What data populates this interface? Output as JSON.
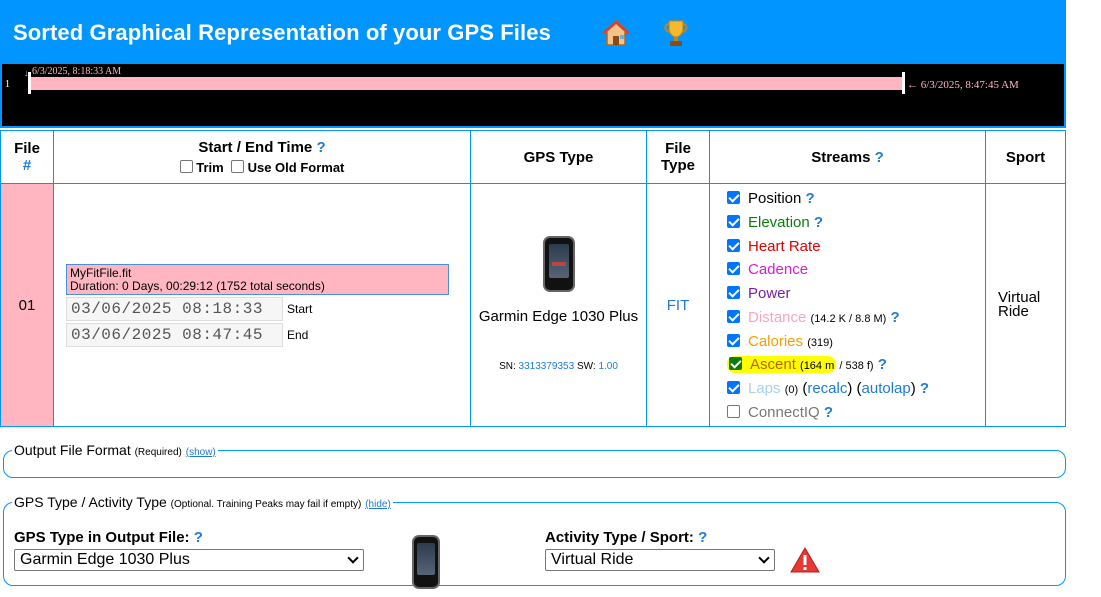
{
  "header": {
    "title": "Sorted Graphical Representation of your GPS Files",
    "home_icon": "house-icon",
    "trophy_icon": "trophy-icon",
    "color": "#0095ff"
  },
  "timeline": {
    "row_number": "1",
    "start_label": "6/3/2025, 8:18:33 AM",
    "end_label": "← 6/3/2025, 8:47:45 AM",
    "bar_color": "#ffb6c1"
  },
  "table": {
    "headers": {
      "file": "File",
      "file_hash": "#",
      "start_end": "Start / End Time",
      "q": "?",
      "trim": "Trim",
      "use_old_format": "Use Old Format",
      "gps_type": "GPS Type",
      "file_type_1": "File",
      "file_type_2": "Type",
      "streams": "Streams",
      "sport": "Sport"
    },
    "row": {
      "number": "01",
      "file_name": "MyFitFile.fit",
      "duration": "Duration: 0 Days, 00:29:12 (1752 total seconds)",
      "start_value": "03/06/2025 08:18:33",
      "start_label": "Start",
      "end_value": "03/06/2025 08:47:45",
      "end_label": "End",
      "gps_name": "Garmin Edge 1030 Plus",
      "sn_label": "SN:",
      "sn_value": "3313379353",
      "sw_label": "SW:",
      "sw_value": "1.00",
      "file_type": "FIT",
      "sport": "Virtual Ride"
    },
    "streams": {
      "position": "Position",
      "elevation": "Elevation",
      "heart_rate": "Heart Rate",
      "cadence": "Cadence",
      "power": "Power",
      "distance": "Distance",
      "distance_detail": "(14.2 K / 8.8 M)",
      "calories": "Calories",
      "calories_detail": "(319)",
      "ascent": "Ascent",
      "ascent_detail_a": "(164 m",
      "ascent_detail_b": "/ 538 f)",
      "laps": "Laps",
      "laps_detail": "(0)",
      "recalc": "recalc",
      "autolap": "autolap",
      "connectiq": "ConnectIQ",
      "q": "?"
    }
  },
  "output_format": {
    "legend": "Output File Format",
    "required": "(Required)",
    "show": "(show)"
  },
  "gps_activity": {
    "legend": "GPS Type / Activity Type",
    "note": "(Optional. Training Peaks may fail if empty)",
    "hide": "(hide)",
    "gps_label": "GPS Type in Output File:",
    "gps_value": "Garmin Edge 1030 Plus",
    "activity_label": "Activity Type / Sport:",
    "activity_value": "Virtual Ride",
    "q": "?"
  }
}
